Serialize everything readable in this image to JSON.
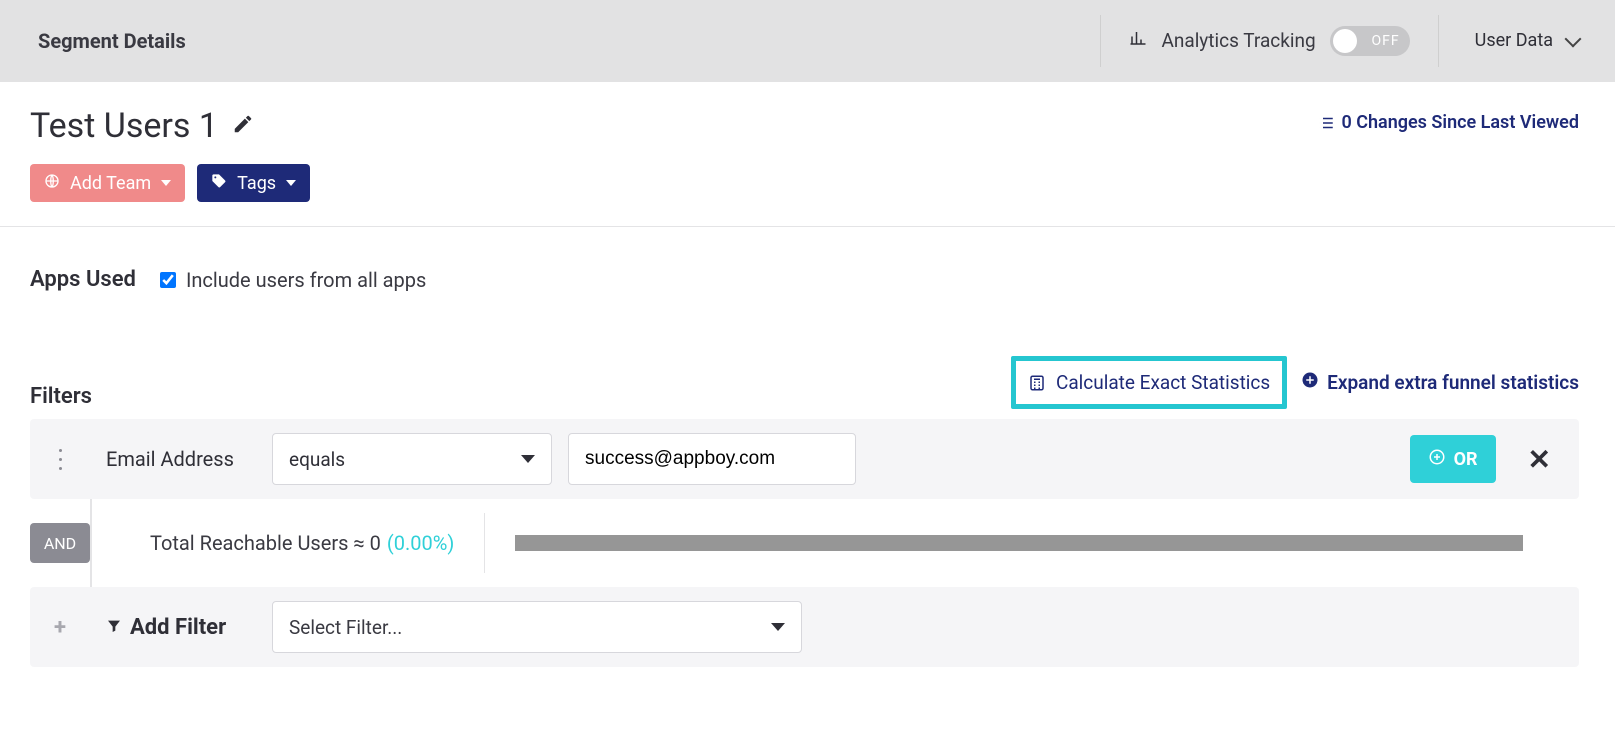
{
  "header": {
    "title": "Segment Details",
    "analytics_label": "Analytics Tracking",
    "analytics_toggle_state": "OFF",
    "user_data_label": "User Data"
  },
  "segment": {
    "name": "Test Users 1",
    "add_team_label": "Add Team",
    "tags_label": "Tags",
    "changes_text": "0 Changes Since Last Viewed"
  },
  "apps": {
    "label": "Apps Used",
    "include_all_label": "Include users from all apps",
    "include_all_checked": true
  },
  "filters": {
    "label": "Filters",
    "calculate_label": "Calculate Exact Statistics",
    "expand_label": "Expand extra funnel statistics"
  },
  "filter_row": {
    "field_label": "Email Address",
    "operator": "equals",
    "value": "success@appboy.com",
    "or_label": "OR"
  },
  "summary": {
    "and_label": "AND",
    "reach_text": "Total Reachable Users ≈ 0",
    "reach_pct": "(0.00%)"
  },
  "add_filter": {
    "label": "Add Filter",
    "placeholder": "Select Filter..."
  }
}
